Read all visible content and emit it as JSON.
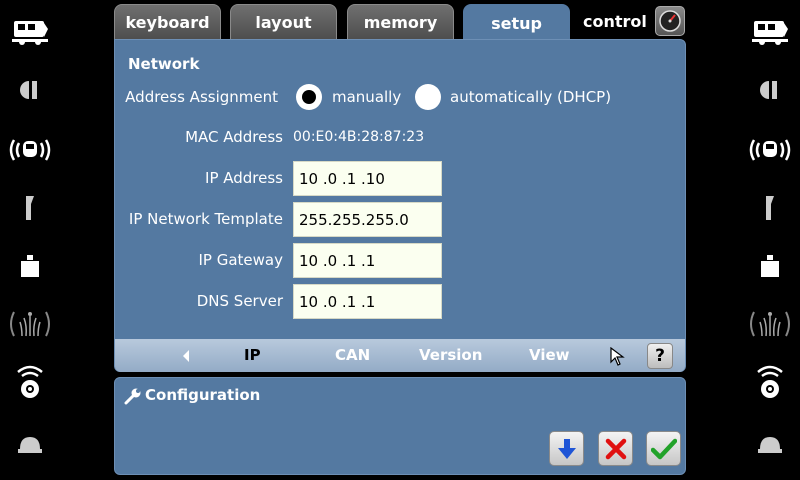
{
  "tabs": [
    {
      "label": "keyboard"
    },
    {
      "label": "layout"
    },
    {
      "label": "memory"
    },
    {
      "label": "setup"
    },
    {
      "label": "control"
    }
  ],
  "network": {
    "title": "Network",
    "address_assignment_label": "Address Assignment",
    "option_manual": "manually",
    "option_dhcp": "automatically (DHCP)",
    "selected": "manually",
    "mac_label": "MAC Address",
    "mac_value": "00:E0:4B:28:87:23",
    "ip_label": "IP Address",
    "ip_value": "10 .0  .1  .10",
    "mask_label": "IP Network Template",
    "mask_value": "255.255.255.0",
    "gateway_label": "IP Gateway",
    "gateway_value": "10 .0  .1  .1",
    "dns_label": "DNS Server",
    "dns_value": "10 .0  .1  .1"
  },
  "subtabs": [
    {
      "label": "IP"
    },
    {
      "label": "CAN"
    },
    {
      "label": "Version"
    },
    {
      "label": "View"
    }
  ],
  "help_label": "?",
  "configuration": {
    "title": "Configuration"
  },
  "colors": {
    "panel": "#5479a1",
    "subbar": "#a7bcd4",
    "field": "#fbfff0",
    "down_arrow": "#1f55d6",
    "cancel": "#e01010",
    "ok": "#22a22a"
  },
  "side_icons": [
    "locomotive-icon",
    "signal-icon",
    "radio-locomotive-icon",
    "switch-icon",
    "weight-icon",
    "fountain-icon",
    "speaker-icon",
    "bell-icon"
  ]
}
